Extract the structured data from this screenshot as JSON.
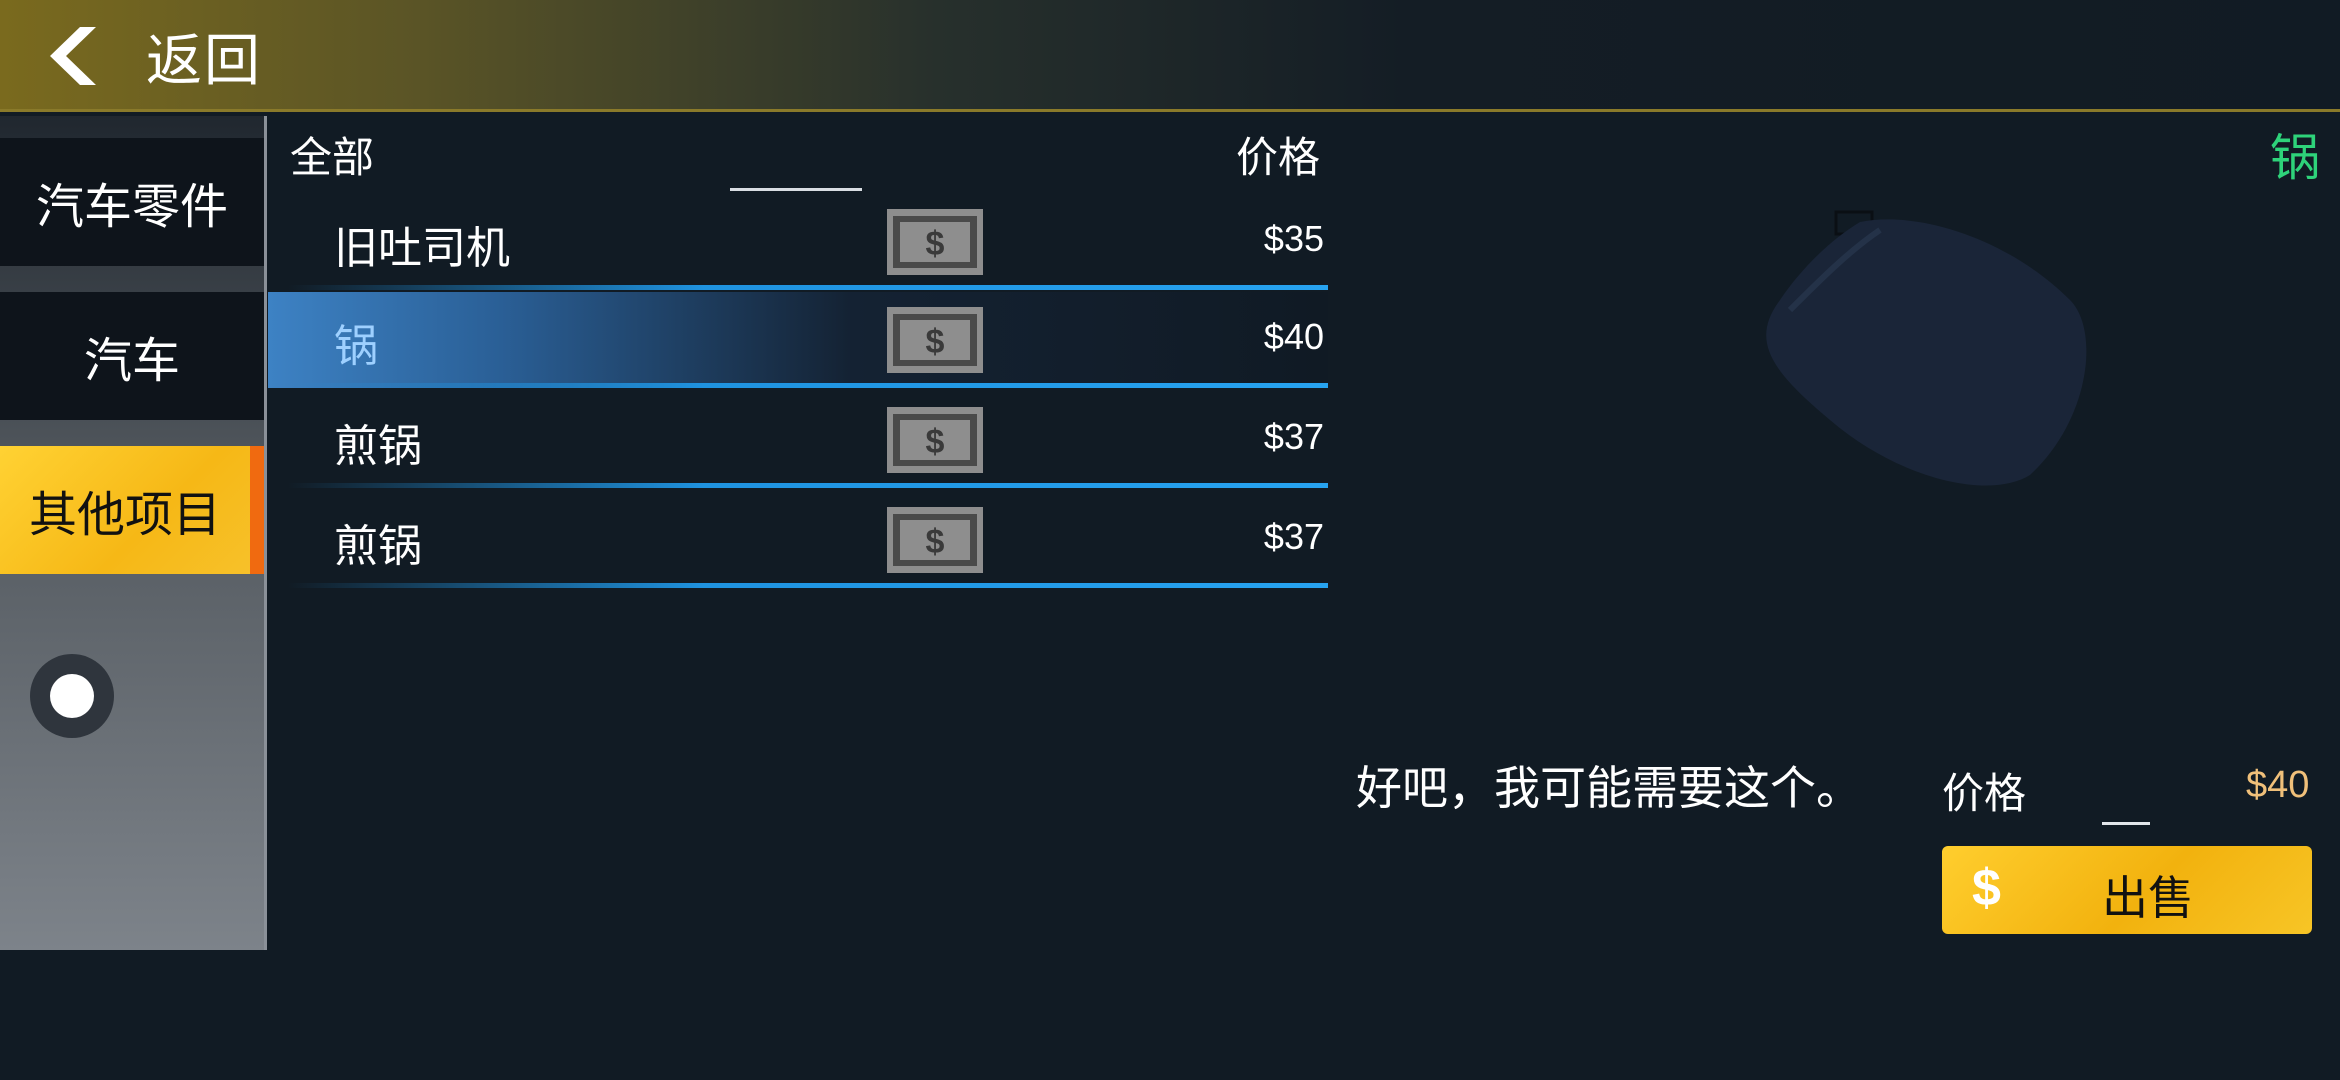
{
  "header": {
    "back_label": "返回"
  },
  "sidebar": {
    "categories": [
      {
        "label": "汽车零件",
        "active": false
      },
      {
        "label": "汽车",
        "active": false
      },
      {
        "label": "其他项目",
        "active": true
      }
    ]
  },
  "list": {
    "filter_label": "全部",
    "price_header": "价格",
    "items": [
      {
        "name": "旧吐司机",
        "price": "$35",
        "selected": false
      },
      {
        "name": "锅",
        "price": "$40",
        "selected": true
      },
      {
        "name": "煎锅",
        "price": "$37",
        "selected": false
      },
      {
        "name": "煎锅",
        "price": "$37",
        "selected": false
      }
    ]
  },
  "detail": {
    "title": "锅",
    "dialogue": "好吧，我可能需要这个。",
    "price_label": "价格",
    "price_value": "$40",
    "sell_icon": "$",
    "sell_label": "出售"
  },
  "colors": {
    "accent_yellow": "#f6b816",
    "accent_orange": "#f06a10",
    "highlight_blue": "#1f93e0",
    "title_green": "#2ed37a",
    "price_gold": "#f0c07a"
  }
}
